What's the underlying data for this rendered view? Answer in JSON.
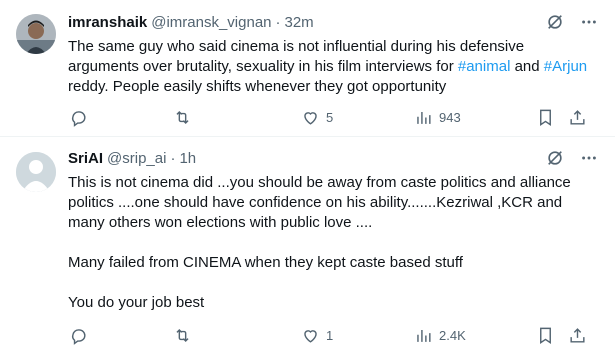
{
  "tweets": [
    {
      "display_name": "imranshaik",
      "handle": "@imransk_vignan",
      "separator": "·",
      "time": "32m",
      "text_segments": [
        {
          "text": "The same guy who said cinema is not influential during his defensive arguments over brutality, sexuality in his film interviews for ",
          "type": "text"
        },
        {
          "text": "#animal",
          "type": "hashtag"
        },
        {
          "text": " and ",
          "type": "text"
        },
        {
          "text": "#Arjun",
          "type": "hashtag"
        },
        {
          "text": " reddy. People easily shifts whenever they got opportunity",
          "type": "text"
        }
      ],
      "actions": {
        "reply_count": "",
        "retweet_count": "",
        "like_count": "5",
        "view_count": "943"
      }
    },
    {
      "display_name": "SriAI",
      "handle": "@srip_ai",
      "separator": "·",
      "time": "1h",
      "paragraphs": [
        "This is not cinema did ...you should be away from caste politics and alliance politics ....one should have confidence on his ability.......Kezriwal ,KCR and many others won elections with public love ....",
        "Many failed from CINEMA when they kept caste based stuff",
        "You do your job best"
      ],
      "actions": {
        "reply_count": "",
        "retweet_count": "",
        "like_count": "1",
        "view_count": "2.4K"
      }
    }
  ],
  "icons": [
    "grok-icon",
    "more-icon",
    "reply-icon",
    "retweet-icon",
    "like-icon",
    "views-icon",
    "bookmark-icon",
    "share-icon"
  ],
  "colors": {
    "text": "#0f1419",
    "secondary": "#536471",
    "link": "#1d9bf0",
    "divider": "#eff3f4"
  }
}
